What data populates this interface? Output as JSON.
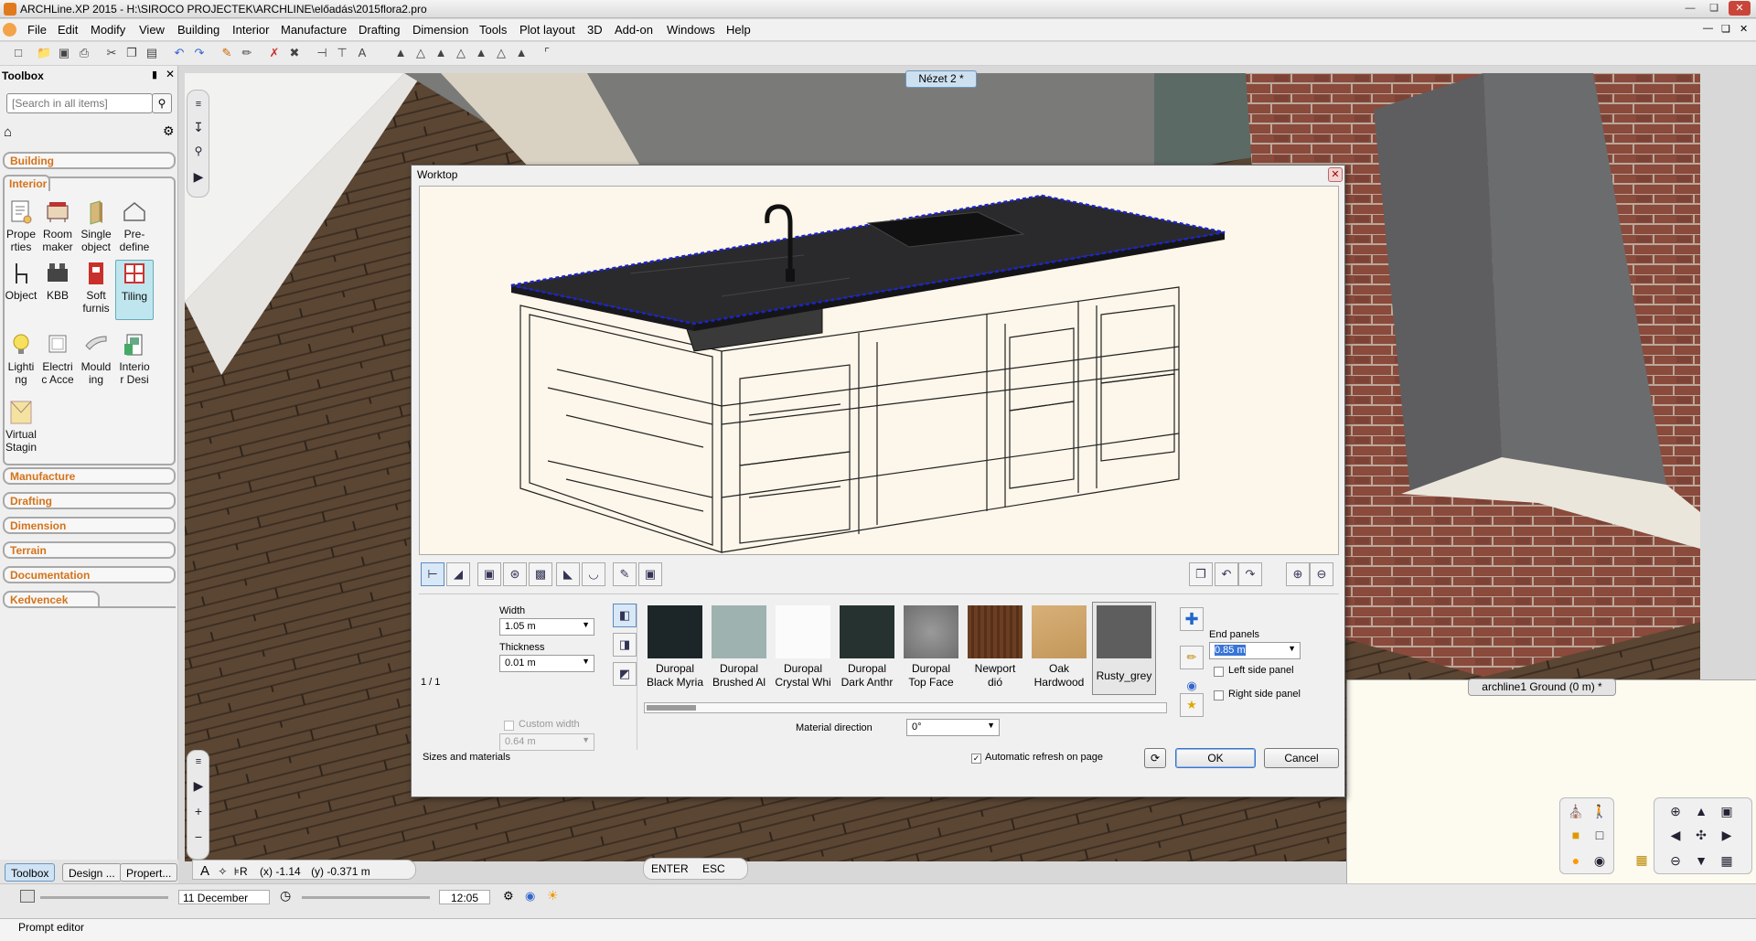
{
  "app": {
    "title": "ARCHLine.XP 2015 - H:\\SIROCO PROJECTEK\\ARCHLINE\\előadás\\2015flora2.pro"
  },
  "menu": [
    "File",
    "Edit",
    "Modify",
    "View",
    "Building",
    "Interior",
    "Manufacture",
    "Drafting",
    "Dimension",
    "Tools",
    "Plot layout",
    "3D",
    "Add-on",
    "Windows",
    "Help"
  ],
  "toolbox": {
    "title": "Toolbox",
    "search_placeholder": "[Search in all items]",
    "categories": {
      "building": "Building",
      "interior": "Interior",
      "manufacture": "Manufacture",
      "drafting": "Drafting",
      "dimension": "Dimension",
      "terrain": "Terrain",
      "documentation": "Documentation",
      "kedvencek": "Kedvencek"
    },
    "tools": [
      {
        "l1": "Prope",
        "l2": "rties"
      },
      {
        "l1": "Room",
        "l2": "maker"
      },
      {
        "l1": "Single",
        "l2": "object"
      },
      {
        "l1": "Pre-",
        "l2": "define"
      },
      {
        "l1": "Object",
        "l2": ""
      },
      {
        "l1": "KBB",
        "l2": ""
      },
      {
        "l1": "Soft",
        "l2": "furnis"
      },
      {
        "l1": "Tiling",
        "l2": ""
      },
      {
        "l1": "Lighti",
        "l2": "ng"
      },
      {
        "l1": "Electri",
        "l2": "c Acce"
      },
      {
        "l1": "Mould",
        "l2": "ing"
      },
      {
        "l1": "Interio",
        "l2": "r Desi"
      },
      {
        "l1": "Virtual",
        "l2": "Stagin"
      }
    ],
    "panel_tabs": [
      "Toolbox",
      "Design ...",
      "Propert..."
    ]
  },
  "viewport": {
    "view_label": "Nézet 2 *",
    "ground_label": "archline1 Ground (0 m) *"
  },
  "coords": {
    "x": "(x) -1.14",
    "y": "(y) -0.371 m"
  },
  "command": {
    "enter": "ENTER",
    "esc": "ESC"
  },
  "status": {
    "date": "11 December",
    "time": "12:05",
    "prompt": "Prompt editor"
  },
  "dialog": {
    "title": "Worktop",
    "page": "1 / 1",
    "width_label": "Width",
    "width_value": "1.05 m",
    "thickness_label": "Thickness",
    "thickness_value": "0.01 m",
    "custom_width_label": "Custom width",
    "custom_width_value": "0.64 m",
    "materials": [
      {
        "l1": "Duropal",
        "l2": "Black Myria",
        "color": "#1c2628"
      },
      {
        "l1": "Duropal",
        "l2": "Brushed Al",
        "color": "#9eb2b0"
      },
      {
        "l1": "Duropal",
        "l2": "Crystal Whi",
        "color": "#fbfbfb"
      },
      {
        "l1": "Duropal",
        "l2": "Dark Anthr",
        "color": "#263230"
      },
      {
        "l1": "Duropal",
        "l2": "Top Face",
        "color": "#8a8a8a"
      },
      {
        "l1": "Newport",
        "l2": "dió",
        "color": "#6a3e22"
      },
      {
        "l1": "Oak",
        "l2": "Hardwood",
        "color": "#d2a86a"
      },
      {
        "l1": "Rusty_grey",
        "l2": "",
        "color": "#5e5e5e"
      }
    ],
    "material_direction_label": "Material direction",
    "material_direction_value": "0°",
    "end_panels_label": "End panels",
    "end_panels_value": "0.85 m",
    "left_side_panel": "Left side panel",
    "right_side_panel": "Right side panel",
    "section_label": "Sizes and materials",
    "auto_refresh": "Automatic refresh on page",
    "ok": "OK",
    "cancel": "Cancel"
  }
}
